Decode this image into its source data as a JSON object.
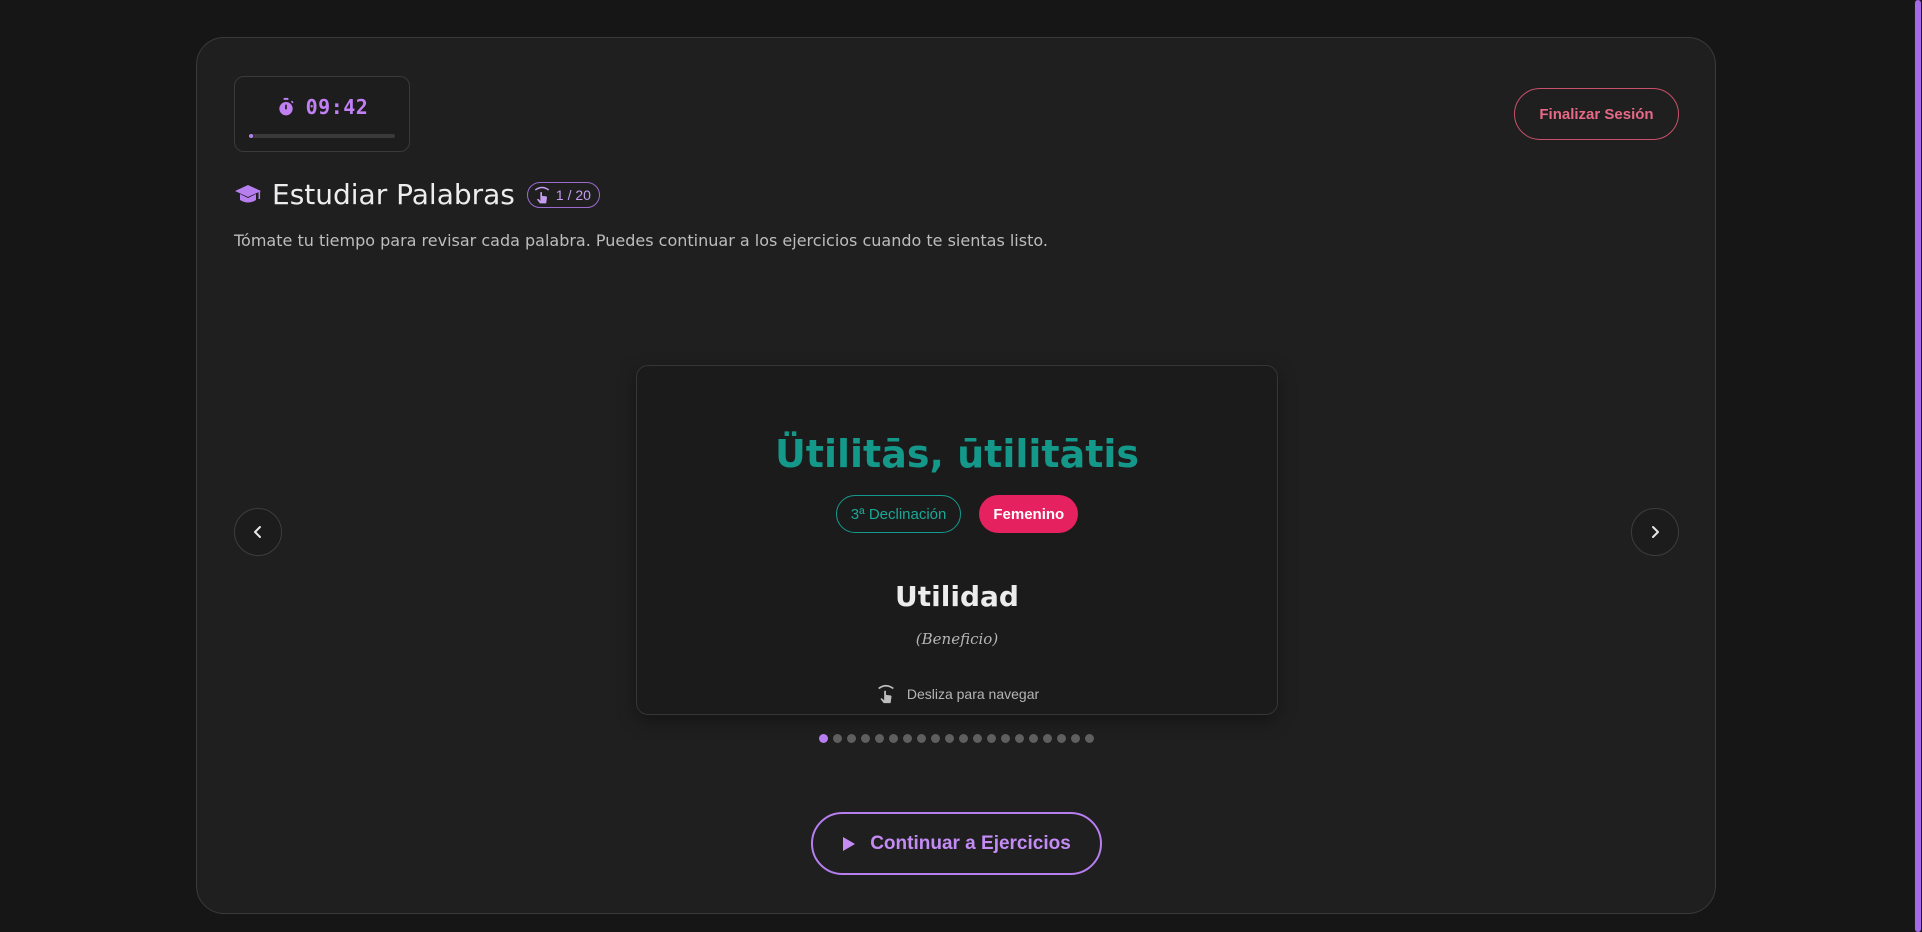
{
  "timer": {
    "value": "09:42",
    "progress_fraction": 0.03,
    "icon": "stopwatch-icon"
  },
  "header": {
    "end_session_label": "Finalizar Sesión"
  },
  "study": {
    "title": "Estudiar Palabras",
    "title_icon": "graduation-cap-icon",
    "counter": "1 / 20",
    "counter_icon": "swipe-icon",
    "subtitle": "Tómate tu tiempo para revisar cada palabra. Puedes continuar a los ejercicios cuando te sientas listo."
  },
  "card": {
    "word": "Ütilitās, ūtilitātis",
    "declension": "3ª Declinación",
    "gender": "Femenino",
    "meaning": "Utilidad",
    "synonym": "(Beneficio)",
    "swipe_hint": "Desliza para navegar"
  },
  "pagination": {
    "total": 20,
    "current": 1
  },
  "actions": {
    "continue_label": "Continuar a Ejercicios",
    "continue_icon": "play-icon"
  },
  "colors": {
    "accent": "#b77ef0",
    "word": "#13988a",
    "gender_badge": "#e5215f",
    "end_session": "#e66a86"
  }
}
